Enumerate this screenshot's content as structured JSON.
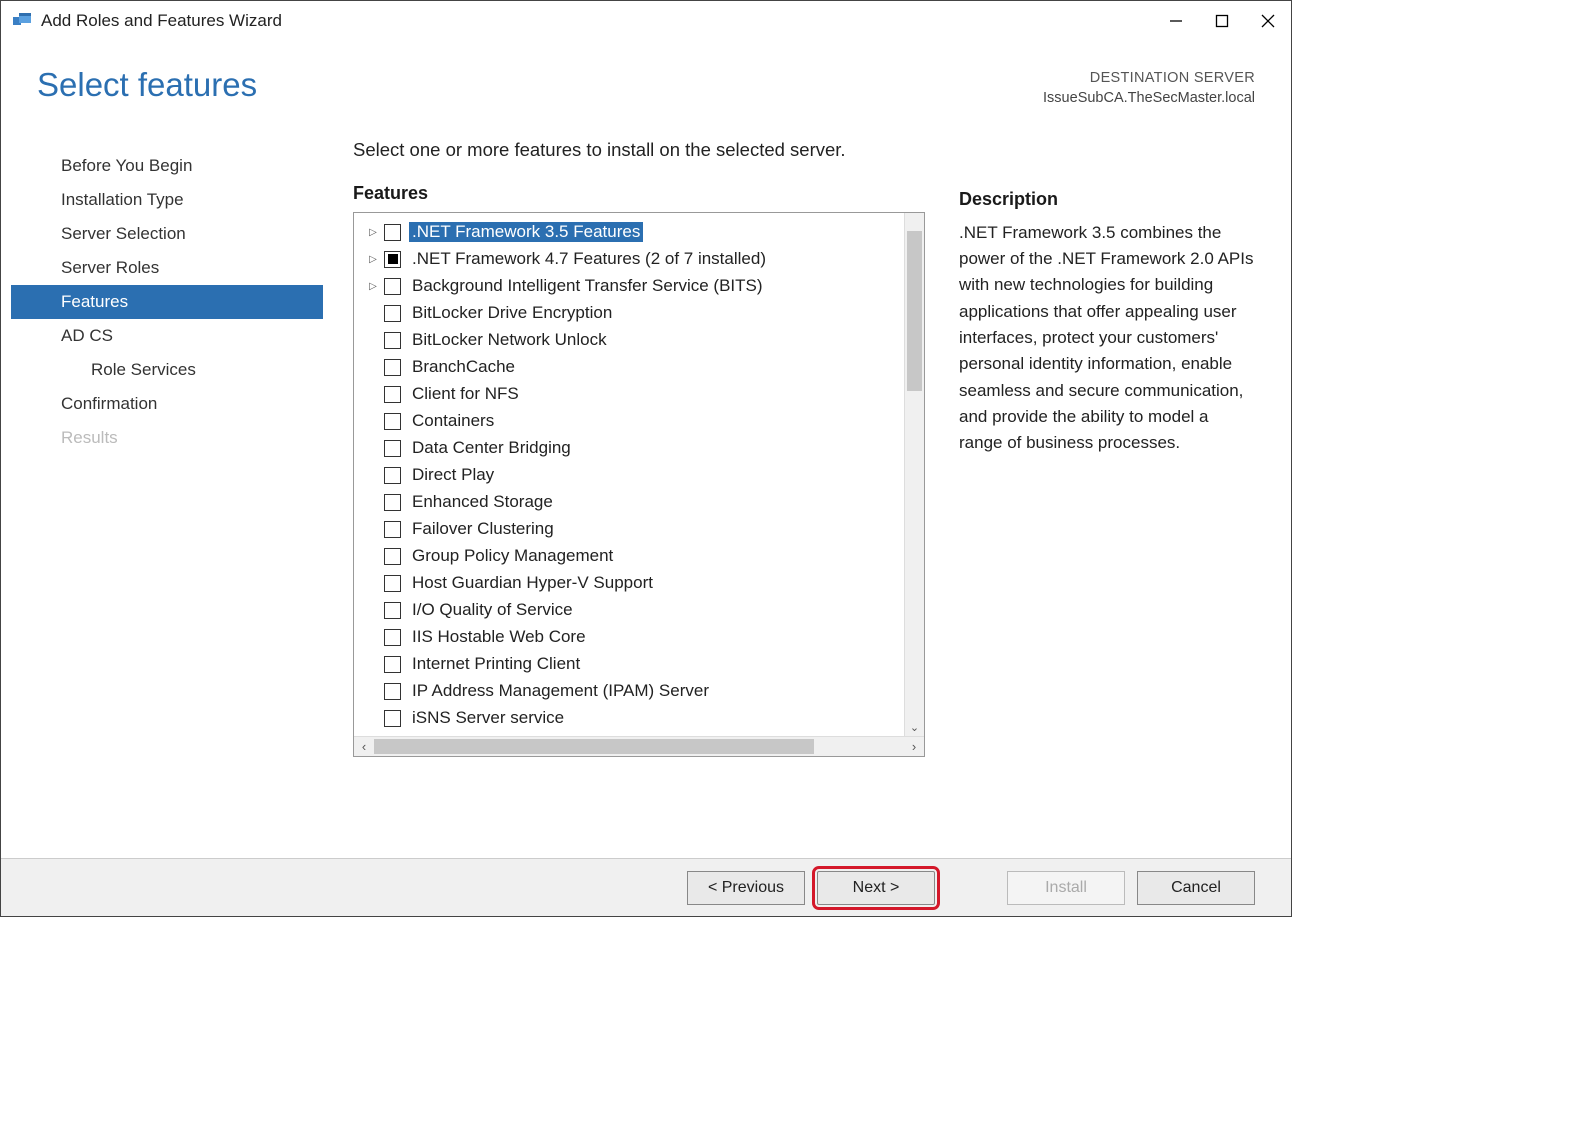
{
  "titlebar": {
    "title": "Add Roles and Features Wizard"
  },
  "page": {
    "title": "Select features",
    "destination_label": "DESTINATION SERVER",
    "destination_value": "IssueSubCA.TheSecMaster.local"
  },
  "steps": [
    {
      "label": "Before You Begin",
      "state": "normal"
    },
    {
      "label": "Installation Type",
      "state": "normal"
    },
    {
      "label": "Server Selection",
      "state": "normal"
    },
    {
      "label": "Server Roles",
      "state": "normal"
    },
    {
      "label": "Features",
      "state": "active"
    },
    {
      "label": "AD CS",
      "state": "normal"
    },
    {
      "label": "Role Services",
      "state": "normal",
      "sub": true
    },
    {
      "label": "Confirmation",
      "state": "normal"
    },
    {
      "label": "Results",
      "state": "disabled"
    }
  ],
  "instruction": "Select one or more features to install on the selected server.",
  "features_label": "Features",
  "description_label": "Description",
  "description_text": ".NET Framework 3.5 combines the power of the .NET Framework 2.0 APIs with new technologies for building applications that offer appealing user interfaces, protect your customers' personal identity information, enable seamless and secure communication, and provide the ability to model a range of business processes.",
  "features": [
    {
      "label": ".NET Framework 3.5 Features",
      "expandable": true,
      "check": "unchecked",
      "selected": true
    },
    {
      "label": ".NET Framework 4.7 Features (2 of 7 installed)",
      "expandable": true,
      "check": "partial"
    },
    {
      "label": "Background Intelligent Transfer Service (BITS)",
      "expandable": true,
      "check": "unchecked"
    },
    {
      "label": "BitLocker Drive Encryption",
      "check": "unchecked"
    },
    {
      "label": "BitLocker Network Unlock",
      "check": "unchecked"
    },
    {
      "label": "BranchCache",
      "check": "unchecked"
    },
    {
      "label": "Client for NFS",
      "check": "unchecked"
    },
    {
      "label": "Containers",
      "check": "unchecked"
    },
    {
      "label": "Data Center Bridging",
      "check": "unchecked"
    },
    {
      "label": "Direct Play",
      "check": "unchecked"
    },
    {
      "label": "Enhanced Storage",
      "check": "unchecked"
    },
    {
      "label": "Failover Clustering",
      "check": "unchecked"
    },
    {
      "label": "Group Policy Management",
      "check": "unchecked"
    },
    {
      "label": "Host Guardian Hyper-V Support",
      "check": "unchecked"
    },
    {
      "label": "I/O Quality of Service",
      "check": "unchecked"
    },
    {
      "label": "IIS Hostable Web Core",
      "check": "unchecked"
    },
    {
      "label": "Internet Printing Client",
      "check": "unchecked"
    },
    {
      "label": "IP Address Management (IPAM) Server",
      "check": "unchecked"
    },
    {
      "label": "iSNS Server service",
      "check": "unchecked"
    }
  ],
  "buttons": {
    "previous": "< Previous",
    "next": "Next >",
    "install": "Install",
    "cancel": "Cancel"
  }
}
